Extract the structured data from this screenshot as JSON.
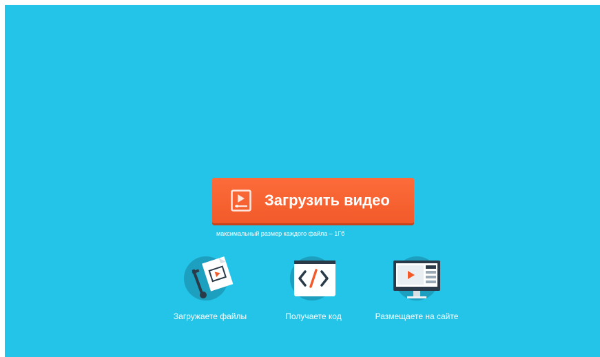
{
  "upload": {
    "button_label": "Загрузить видео",
    "hint": "максимальный размер каждого файла – 1Гб",
    "button_icon": "video-play-icon"
  },
  "steps": [
    {
      "label": "Загружаете файлы",
      "icon": "file-cart-icon"
    },
    {
      "label": "Получаете код",
      "icon": "code-icon"
    },
    {
      "label": "Размещаете на сайте",
      "icon": "monitor-icon"
    }
  ],
  "colors": {
    "background": "#23c4e7",
    "button": "#f4612e",
    "icon_circle": "#1d9fbf"
  }
}
